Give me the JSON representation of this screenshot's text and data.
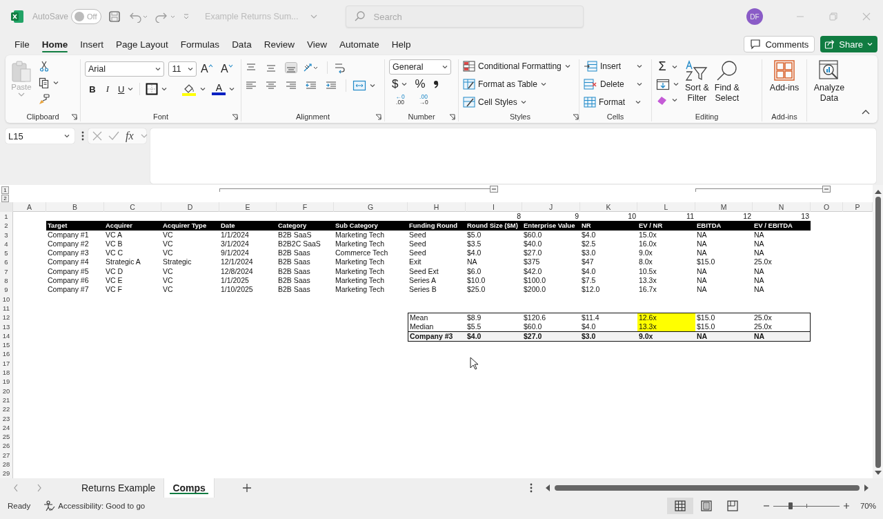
{
  "title_bar": {
    "autosave_label": "AutoSave",
    "autosave_toggle": {
      "label": "Off",
      "on": false
    },
    "document_title": "Example Returns Sum...",
    "search": {
      "placeholder": "Search"
    },
    "avatar": "DF"
  },
  "menu_tabs": [
    {
      "label": "File",
      "selected": false
    },
    {
      "label": "Home",
      "selected": true
    },
    {
      "label": "Insert",
      "selected": false
    },
    {
      "label": "Page Layout",
      "selected": false
    },
    {
      "label": "Formulas",
      "selected": false
    },
    {
      "label": "Data",
      "selected": false
    },
    {
      "label": "Review",
      "selected": false
    },
    {
      "label": "View",
      "selected": false
    },
    {
      "label": "Automate",
      "selected": false
    },
    {
      "label": "Help",
      "selected": false
    }
  ],
  "comments_button": "Comments",
  "share_button": "Share",
  "ribbon": {
    "clipboard": {
      "paste": {
        "label": "Paste",
        "disabled": true
      },
      "group_label": "Clipboard"
    },
    "font": {
      "font_name": "Arial",
      "font_size": "11",
      "grow": "A",
      "shrink": "A",
      "bold": "B",
      "italic": "I",
      "underline": "U",
      "font_color": "A",
      "group_label": "Font"
    },
    "alignment": {
      "group_label": "Alignment"
    },
    "number": {
      "format": "General",
      "currency": "$",
      "percent": "%",
      "decimals": [
        {
          "top": "←0",
          "bottom": ".00"
        },
        {
          "top": ".00",
          "bottom": "→0"
        }
      ],
      "group_label": "Number"
    },
    "styles": {
      "items": [
        "Conditional Formatting",
        "Format as Table",
        "Cell Styles"
      ],
      "group_label": "Styles"
    },
    "cells": {
      "items": [
        "Insert",
        "Delete",
        "Format"
      ],
      "group_label": "Cells"
    },
    "editing": {
      "autosum": "Σ",
      "sort_filter": [
        "Sort &",
        "Filter"
      ],
      "find_select": [
        "Find &",
        "Select"
      ],
      "group_label": "Editing"
    },
    "addins": {
      "button": "Add-ins",
      "group_label": "Add-ins"
    },
    "analyze": {
      "button": [
        "Analyze",
        "Data"
      ]
    }
  },
  "formula_bar": {
    "name_box": "L15",
    "fx": "fx"
  },
  "outline": {
    "levels": [
      "1",
      "2"
    ]
  },
  "sheet": {
    "column_headers": [
      "A",
      "B",
      "C",
      "D",
      "E",
      "F",
      "G",
      "H",
      "I",
      "J",
      "K",
      "L",
      "M",
      "N",
      "O",
      "P"
    ],
    "rows": [
      {
        "number": "1",
        "kind": "plain",
        "cells": [
          null,
          null,
          null,
          null,
          null,
          null,
          null,
          {
            "text": "8",
            "kind": "number"
          },
          {
            "text": "9",
            "kind": "number"
          },
          {
            "text": "10",
            "kind": "number"
          },
          {
            "text": "11",
            "kind": "number"
          },
          {
            "text": "12",
            "kind": "number"
          },
          {
            "text": "13",
            "kind": "number"
          }
        ]
      },
      {
        "number": "2",
        "kind": "header",
        "cells": [
          "Target",
          "Acquirer",
          "Acquirer Type",
          "Date",
          "Category",
          "Sub Category",
          "Funding Round",
          "Round Size ($M)",
          "Enterprise Value",
          "NR",
          "EV / NR",
          "EBITDA",
          "EV / EBITDA"
        ]
      },
      {
        "number": "3",
        "kind": "plain",
        "cells": [
          "Company #1",
          "VC A",
          "VC",
          "1/1/2024",
          "B2B SaaS",
          "Marketing Tech",
          "Seed",
          "$5.0",
          "$60.0",
          "$4.0",
          "15.0x",
          "NA",
          "NA"
        ]
      },
      {
        "number": "4",
        "kind": "plain",
        "cells": [
          "Company #2",
          "VC B",
          "VC",
          "3/1/2024",
          "B2B2C SaaS",
          "Marketing Tech",
          "Seed",
          "$3.5",
          "$40.0",
          "$2.5",
          "16.0x",
          "NA",
          "NA"
        ]
      },
      {
        "number": "5",
        "kind": "plain",
        "cells": [
          "Company #3",
          "VC C",
          "VC",
          "9/1/2024",
          "B2B Saas",
          "Commerce Tech",
          "Seed",
          "$4.0",
          "$27.0",
          "$3.0",
          "9.0x",
          "NA",
          "NA"
        ]
      },
      {
        "number": "6",
        "kind": "plain",
        "cells": [
          "Company #4",
          "Strategic A",
          "Strategic",
          "12/1/2024",
          "B2B Saas",
          "Marketing Tech",
          "Exit",
          "NA",
          "$375",
          "$47",
          "8.0x",
          "$15.0",
          "25.0x"
        ]
      },
      {
        "number": "7",
        "kind": "plain",
        "cells": [
          "Company #5",
          "VC D",
          "VC",
          "12/8/2024",
          "B2B Saas",
          "Marketing Tech",
          "Seed Ext",
          "$6.0",
          "$42.0",
          "$4.0",
          "10.5x",
          "NA",
          "NA"
        ]
      },
      {
        "number": "8",
        "kind": "plain",
        "cells": [
          "Company #6",
          "VC E",
          "VC",
          "1/1/2025",
          "B2B Saas",
          "Marketing Tech",
          "Series A",
          "$10.0",
          "$100.0",
          "$7.5",
          "13.3x",
          "NA",
          "NA"
        ]
      },
      {
        "number": "9",
        "kind": "plain",
        "cells": [
          "Company #7",
          "VC F",
          "VC",
          "1/10/2025",
          "B2B Saas",
          "Marketing Tech",
          "Series B",
          "$25.0",
          "$200.0",
          "$12.0",
          "16.7x",
          "NA",
          "NA"
        ]
      },
      {
        "number": "10",
        "kind": "plain"
      },
      {
        "number": "11",
        "kind": "plain"
      },
      {
        "number": "12",
        "kind": "summary",
        "cells": [
          null,
          null,
          null,
          null,
          null,
          null,
          "Mean",
          "$8.9",
          "$120.6",
          "$11.4",
          {
            "text": "12.6x",
            "highlighted": true
          },
          "$15.0",
          "25.0x"
        ]
      },
      {
        "number": "13",
        "kind": "summary",
        "cells": [
          null,
          null,
          null,
          null,
          null,
          null,
          "Median",
          "$5.5",
          "$60.0",
          "$4.0",
          {
            "text": "13.3x",
            "highlighted": true
          },
          "$15.0",
          "25.0x"
        ]
      },
      {
        "number": "14",
        "kind": "total",
        "cells": [
          null,
          null,
          null,
          null,
          null,
          null,
          "Company #3",
          "$4.0",
          "$27.0",
          "$3.0",
          "9.0x",
          "NA",
          "NA"
        ]
      },
      {
        "number": "15",
        "kind": "plain"
      },
      {
        "number": "16",
        "kind": "plain"
      },
      {
        "number": "17",
        "kind": "plain"
      },
      {
        "number": "18",
        "kind": "plain"
      },
      {
        "number": "19",
        "kind": "plain"
      },
      {
        "number": "20",
        "kind": "plain"
      },
      {
        "number": "21",
        "kind": "plain"
      },
      {
        "number": "22",
        "kind": "plain"
      },
      {
        "number": "23",
        "kind": "plain"
      },
      {
        "number": "24",
        "kind": "plain"
      },
      {
        "number": "25",
        "kind": "plain"
      },
      {
        "number": "26",
        "kind": "plain"
      },
      {
        "number": "27",
        "kind": "plain"
      },
      {
        "number": "28",
        "kind": "plain"
      },
      {
        "number": "29",
        "kind": "plain"
      }
    ]
  },
  "sheet_tabs": [
    {
      "label": "Returns Example",
      "selected": false
    },
    {
      "label": "Comps",
      "selected": true
    }
  ],
  "status_bar": {
    "ready": "Ready",
    "accessibility": "Accessibility: Good to go",
    "views": [
      {
        "kind": "normal",
        "selected": true
      },
      {
        "kind": "page-layout",
        "selected": false
      },
      {
        "kind": "page-break",
        "selected": false
      }
    ],
    "zoom": {
      "level": 0.26,
      "label": "70%"
    }
  }
}
